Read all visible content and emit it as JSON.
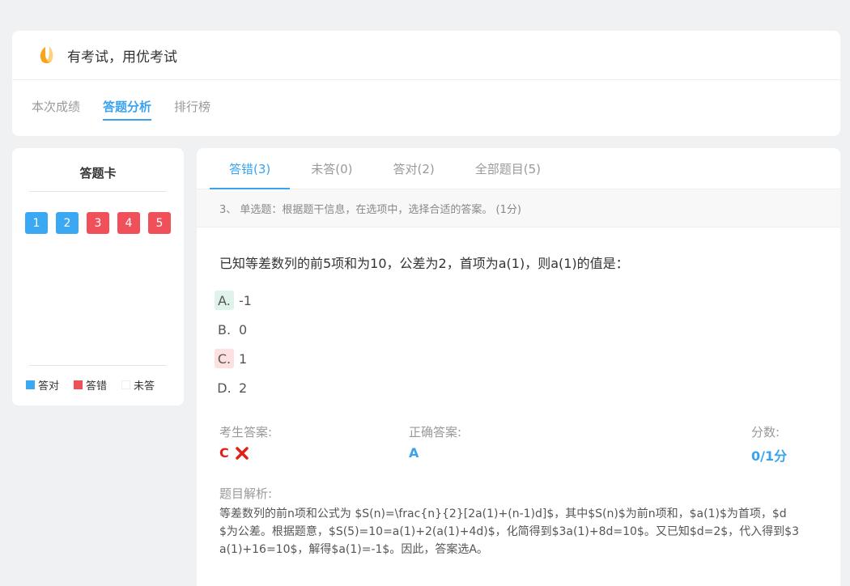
{
  "brand": {
    "title": "有考试，用优考试"
  },
  "top_tabs": [
    {
      "label": "本次成绩",
      "active": false
    },
    {
      "label": "答题分析",
      "active": true
    },
    {
      "label": "排行榜",
      "active": false
    }
  ],
  "answer_card": {
    "title": "答题卡",
    "questions": [
      {
        "label": "1",
        "status": "correct"
      },
      {
        "label": "2",
        "status": "correct"
      },
      {
        "label": "3",
        "status": "wrong"
      },
      {
        "label": "4",
        "status": "wrong"
      },
      {
        "label": "5",
        "status": "wrong"
      }
    ],
    "legend": [
      {
        "label": "答对",
        "status": "correct"
      },
      {
        "label": "答错",
        "status": "wrong"
      },
      {
        "label": "未答",
        "status": "none"
      }
    ]
  },
  "filter_tabs": [
    {
      "label": "答错(3)",
      "active": true
    },
    {
      "label": "未答(0)",
      "active": false
    },
    {
      "label": "答对(2)",
      "active": false
    },
    {
      "label": "全部题目(5)",
      "active": false
    }
  ],
  "question": {
    "header": "3、 单选题：根据题干信息，在选项中，选择合适的答案。 (1分)",
    "stem": "已知等差数列的前5项和为10，公差为2，首项为a(1)，则a(1)的值是：",
    "options": [
      {
        "letter": "A.",
        "text": "-1",
        "state": "right"
      },
      {
        "letter": "B.",
        "text": "0",
        "state": ""
      },
      {
        "letter": "C.",
        "text": "1",
        "state": "wrong"
      },
      {
        "letter": "D.",
        "text": "2",
        "state": ""
      }
    ],
    "student_answer_label": "考生答案:",
    "student_answer": "C",
    "correct_answer_label": "正确答案:",
    "correct_answer": "A",
    "score_label": "分数:",
    "score": "0/1分",
    "analysis_label": "题目解析:",
    "analysis": "等差数列的前n项和公式为 $S(n)=\\frac{n}{2}[2a(1)+(n-1)d]$，其中$S(n)$为前n项和，$a(1)$为首项，$d$为公差。根据题意，$S(5)=10=a(1)+2(a(1)+4d)$，化简得到$3a(1)+8d=10$。又已知$d=2$，代入得到$3a(1)+16=10$，解得$a(1)=-1$。因此，答案选A。"
  },
  "colors": {
    "accent": "#3aa3f0",
    "correct": "#3aa8f2",
    "wrong": "#f0505a",
    "error_text": "#e0201a"
  }
}
